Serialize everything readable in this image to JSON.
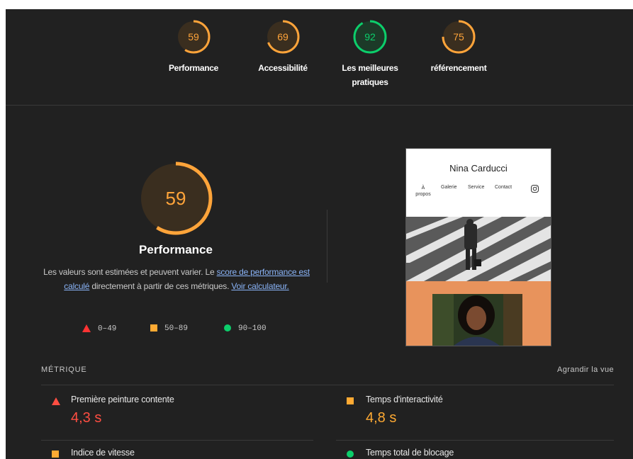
{
  "gauges": [
    {
      "score": 59,
      "label_lines": [
        "Performance"
      ],
      "color": "#ffa43a"
    },
    {
      "score": 69,
      "label_lines": [
        "Accessibilité"
      ],
      "color": "#ffa43a"
    },
    {
      "score": 92,
      "label_lines": [
        "Les meilleures",
        "pratiques"
      ],
      "color": "#0cce6b"
    },
    {
      "score": 75,
      "label_lines": [
        "référencement"
      ],
      "color": "#ffa43a"
    }
  ],
  "performance": {
    "score": 59,
    "title": "Performance",
    "desc_1": "Les valeurs sont estimées et peuvent varier. Le ",
    "desc_link_1": "score de performance est calculé",
    "desc_2": " directement à partir de ces métriques. ",
    "desc_link_2": "Voir calculateur."
  },
  "legend": [
    {
      "shape": "triangle",
      "range": "0–49",
      "color": "#ff3333"
    },
    {
      "shape": "square",
      "range": "50–89",
      "color": "#ffaa33"
    },
    {
      "shape": "circle",
      "range": "90–100",
      "color": "#0cce6b"
    }
  ],
  "preview": {
    "site_name": "Nina Carducci",
    "nav": [
      "À propos",
      "Galerie",
      "Service",
      "Contact"
    ],
    "icons": [
      "instagram-icon"
    ]
  },
  "metrics": {
    "title": "MÉTRIQUE",
    "expand_label": "Agrandir la vue",
    "items": [
      {
        "name": "Première peinture contente",
        "value": "4,3 s",
        "shape": "triangle",
        "color": "#ff4e42"
      },
      {
        "name": "Temps d'interactivité",
        "value": "4,8 s",
        "shape": "square",
        "color": "#ffaa33"
      },
      {
        "name": "Indice de vitesse",
        "value": "",
        "shape": "square",
        "color": "#ffaa33"
      },
      {
        "name": "Temps total de blocage",
        "value": "",
        "shape": "circle",
        "color": "#0cce6b"
      }
    ]
  },
  "colors": {
    "average": "#ffa43a",
    "pass": "#0cce6b",
    "fail": "#ff4e42",
    "background": "#212121"
  }
}
